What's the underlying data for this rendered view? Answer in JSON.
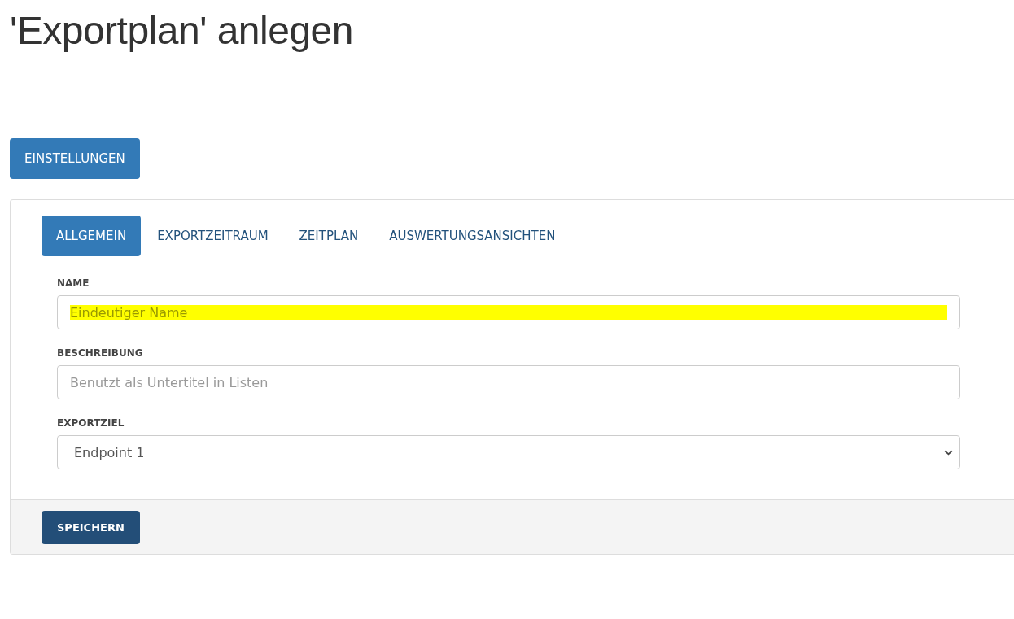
{
  "page_title": "'Exportplan' anlegen",
  "settings_button": "EINSTELLUNGEN",
  "tabs": [
    {
      "label": "ALLGEMEIN",
      "selected": true
    },
    {
      "label": "EXPORTZEITRAUM",
      "selected": false
    },
    {
      "label": "ZEITPLAN",
      "selected": false
    },
    {
      "label": "AUSWERTUNGSANSICHTEN",
      "selected": false
    }
  ],
  "fields": [
    {
      "kind": "text",
      "label": "NAME",
      "placeholder": "Eindeutiger Name",
      "highlighted": true
    },
    {
      "kind": "text",
      "label": "BESCHREIBUNG",
      "placeholder": "Benutzt als Untertitel in Listen",
      "highlighted": false
    },
    {
      "kind": "select",
      "label": "EXPORTZIEL",
      "value": "Endpoint 1"
    }
  ],
  "save_button": "SPEICHERN"
}
